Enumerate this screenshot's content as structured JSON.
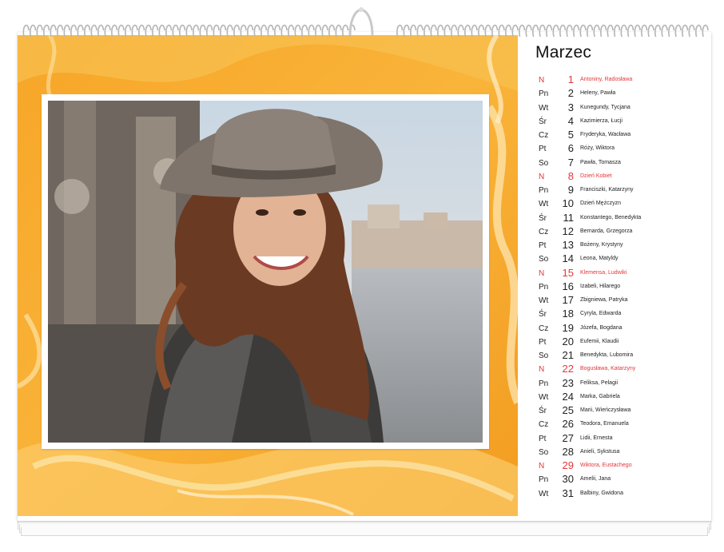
{
  "calendar": {
    "month": "Marzec",
    "colors": {
      "accent": "#f6a526",
      "holiday": "#e5353a",
      "text": "#222222"
    },
    "days": [
      {
        "dow": "N",
        "num": "1",
        "names": "Antoniny, Radosława",
        "holiday": true
      },
      {
        "dow": "Pn",
        "num": "2",
        "names": "Heleny, Pawła",
        "holiday": false
      },
      {
        "dow": "Wt",
        "num": "3",
        "names": "Kunegundy, Tycjana",
        "holiday": false
      },
      {
        "dow": "Śr",
        "num": "4",
        "names": "Kazimierza, Łucji",
        "holiday": false
      },
      {
        "dow": "Cz",
        "num": "5",
        "names": "Fryderyka, Wacława",
        "holiday": false
      },
      {
        "dow": "Pt",
        "num": "6",
        "names": "Róży, Wiktora",
        "holiday": false
      },
      {
        "dow": "So",
        "num": "7",
        "names": "Pawła, Tomasza",
        "holiday": false
      },
      {
        "dow": "N",
        "num": "8",
        "names": "Dzień Kobiet",
        "holiday": true
      },
      {
        "dow": "Pn",
        "num": "9",
        "names": "Franciszki, Katarzyny",
        "holiday": false
      },
      {
        "dow": "Wt",
        "num": "10",
        "names": "Dzień Mężczyzn",
        "holiday": false
      },
      {
        "dow": "Śr",
        "num": "11",
        "names": "Konstantego, Benedykta",
        "holiday": false
      },
      {
        "dow": "Cz",
        "num": "12",
        "names": "Bernarda, Grzegorza",
        "holiday": false
      },
      {
        "dow": "Pt",
        "num": "13",
        "names": "Bożeny, Krystyny",
        "holiday": false
      },
      {
        "dow": "So",
        "num": "14",
        "names": "Leona, Matyldy",
        "holiday": false
      },
      {
        "dow": "N",
        "num": "15",
        "names": "Klemensa, Ludwiki",
        "holiday": true
      },
      {
        "dow": "Pn",
        "num": "16",
        "names": "Izabeli, Hilarego",
        "holiday": false
      },
      {
        "dow": "Wt",
        "num": "17",
        "names": "Zbigniewa, Patryka",
        "holiday": false
      },
      {
        "dow": "Śr",
        "num": "18",
        "names": "Cyryla, Edwarda",
        "holiday": false
      },
      {
        "dow": "Cz",
        "num": "19",
        "names": "Józefa, Bogdana",
        "holiday": false
      },
      {
        "dow": "Pt",
        "num": "20",
        "names": "Eufemii, Klaudii",
        "holiday": false
      },
      {
        "dow": "So",
        "num": "21",
        "names": "Benedykta, Lubomira",
        "holiday": false
      },
      {
        "dow": "N",
        "num": "22",
        "names": "Bogusława, Katarzyny",
        "holiday": true
      },
      {
        "dow": "Pn",
        "num": "23",
        "names": "Feliksa, Pelagii",
        "holiday": false
      },
      {
        "dow": "Wt",
        "num": "24",
        "names": "Marka, Gabriela",
        "holiday": false
      },
      {
        "dow": "Śr",
        "num": "25",
        "names": "Marii, Wieńczysława",
        "holiday": false
      },
      {
        "dow": "Cz",
        "num": "26",
        "names": "Teodora, Emanuela",
        "holiday": false
      },
      {
        "dow": "Pt",
        "num": "27",
        "names": "Lidii, Ernesta",
        "holiday": false
      },
      {
        "dow": "So",
        "num": "28",
        "names": "Anieli, Sykstusa",
        "holiday": false
      },
      {
        "dow": "N",
        "num": "29",
        "names": "Wiktora, Eustachego",
        "holiday": true
      },
      {
        "dow": "Pn",
        "num": "30",
        "names": "Amelii, Jana",
        "holiday": false
      },
      {
        "dow": "Wt",
        "num": "31",
        "names": "Balbiny, Gwidona",
        "holiday": false
      }
    ]
  },
  "binding": {
    "icon": "spiral-binding-icon",
    "hanger_icon": "hanger-hook-icon"
  },
  "photo": {
    "icon": "woman-in-hat-photo"
  }
}
